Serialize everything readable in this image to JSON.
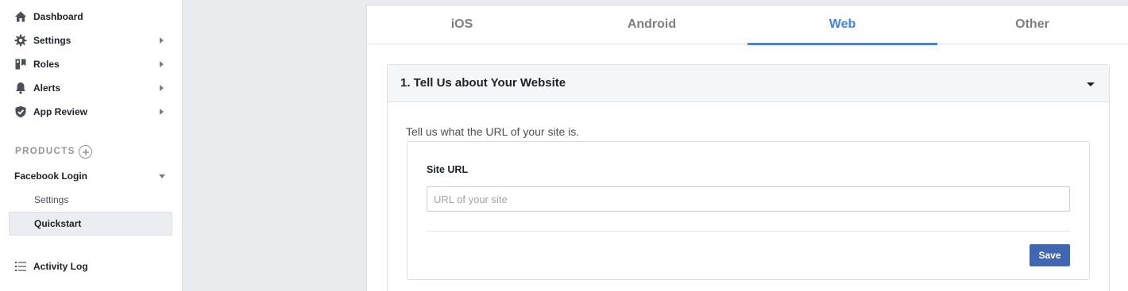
{
  "sidebar": {
    "items": [
      {
        "label": "Dashboard",
        "icon": "home-icon",
        "has_submenu": false
      },
      {
        "label": "Settings",
        "icon": "gear-icon",
        "has_submenu": true
      },
      {
        "label": "Roles",
        "icon": "roles-icon",
        "has_submenu": true
      },
      {
        "label": "Alerts",
        "icon": "bell-icon",
        "has_submenu": true
      },
      {
        "label": "App Review",
        "icon": "shield-check-icon",
        "has_submenu": true
      }
    ],
    "products_title": "PRODUCTS",
    "product": {
      "label": "Facebook Login",
      "expanded": true,
      "sub_items": [
        {
          "label": "Settings",
          "active": false
        },
        {
          "label": "Quickstart",
          "active": true
        }
      ]
    },
    "activity_log": {
      "label": "Activity Log",
      "icon": "list-icon"
    }
  },
  "tabs": [
    {
      "label": "iOS",
      "active": false
    },
    {
      "label": "Android",
      "active": false
    },
    {
      "label": "Web",
      "active": true
    },
    {
      "label": "Other",
      "active": false
    }
  ],
  "panel": {
    "title": "1. Tell Us about Your Website",
    "description": "Tell us what the URL of your site is.",
    "field_label": "Site URL",
    "input_value": "",
    "input_placeholder": "URL of your site",
    "save_label": "Save"
  },
  "colors": {
    "accent": "#4080ff",
    "button": "#4267b2",
    "page_bg": "#e9ebee"
  }
}
